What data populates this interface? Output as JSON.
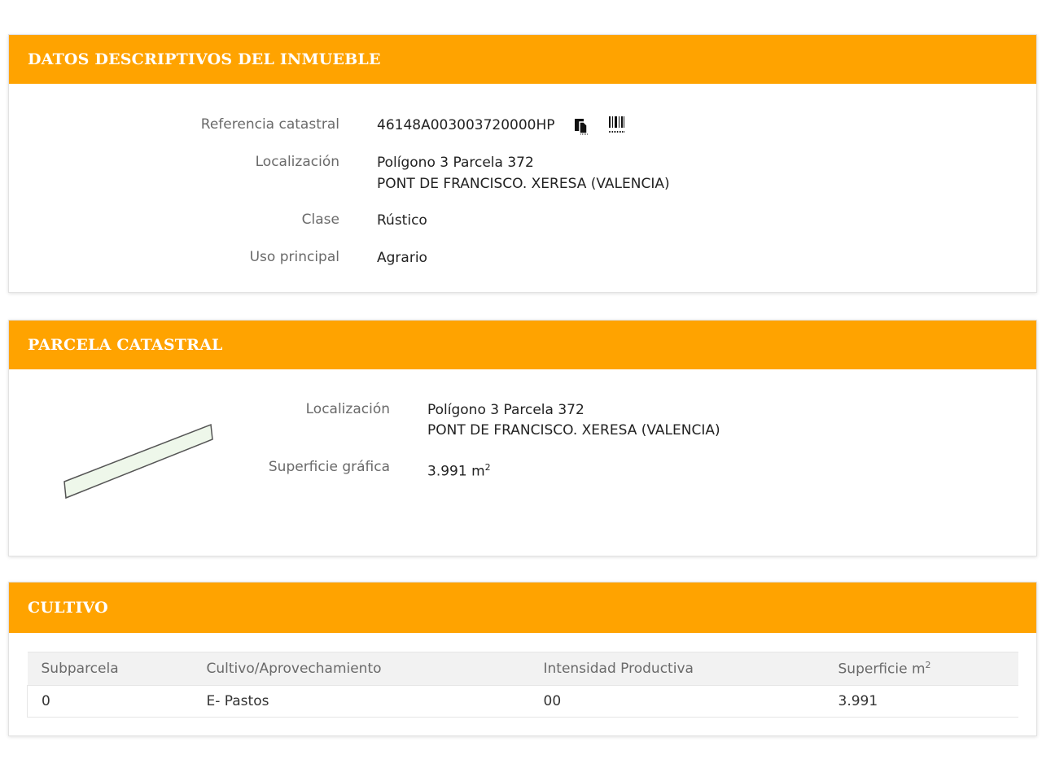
{
  "panel1": {
    "title": "DATOS DESCRIPTIVOS DEL INMUEBLE",
    "ref_label": "Referencia catastral",
    "ref_value": "46148A003003720000HP",
    "loc_label": "Localización",
    "loc_line1": "Polígono 3 Parcela 372",
    "loc_line2": "PONT DE FRANCISCO. XERESA (VALENCIA)",
    "clase_label": "Clase",
    "clase_value": "Rústico",
    "uso_label": "Uso principal",
    "uso_value": "Agrario",
    "icons": [
      "copy-icon",
      "barcode-icon"
    ]
  },
  "panel2": {
    "title": "PARCELA CATASTRAL",
    "loc_label": "Localización",
    "loc_line1": "Polígono 3 Parcela 372",
    "loc_line2": "PONT DE FRANCISCO. XERESA (VALENCIA)",
    "sup_label": "Superficie gráfica",
    "sup_value": "3.991 m",
    "sup_exp": "2",
    "parcel_fill": "#eef7ea"
  },
  "panel3": {
    "title": "CULTIVO",
    "columns": [
      "Subparcela",
      "Cultivo/Aprovechamiento",
      "Intensidad Productiva",
      "Superficie m"
    ],
    "col4_exp": "2",
    "rows": [
      [
        "0",
        "E- Pastos",
        "00",
        "3.991"
      ]
    ]
  },
  "colors": {
    "header": "#ffa300",
    "header_text": "#ffffff"
  }
}
